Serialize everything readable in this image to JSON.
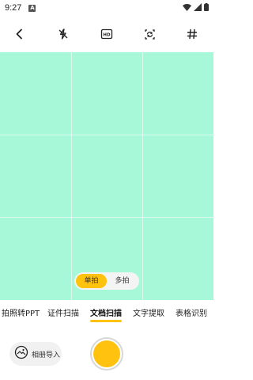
{
  "status_bar": {
    "time": "9:27",
    "notification_badge": "A"
  },
  "toolbar": {
    "icons": [
      "back-arrow-icon",
      "flash-off-icon",
      "hd-icon",
      "camera-switch-icon",
      "grid-icon"
    ],
    "hd_label": "HD"
  },
  "camera": {
    "background_color": "#a6f8d8"
  },
  "shot_toggle": {
    "single_label": "单拍",
    "multi_label": "多拍",
    "selected": "单拍"
  },
  "modes": {
    "items": [
      {
        "label": "拍照转PPT"
      },
      {
        "label": "证件扫描"
      },
      {
        "label": "文档扫描"
      },
      {
        "label": "文字提取"
      },
      {
        "label": "表格识别"
      }
    ],
    "active": "文档扫描"
  },
  "bottom": {
    "album_label": "相册导入"
  },
  "colors": {
    "accent": "#ffc20e",
    "preview": "#a6f8d8"
  }
}
